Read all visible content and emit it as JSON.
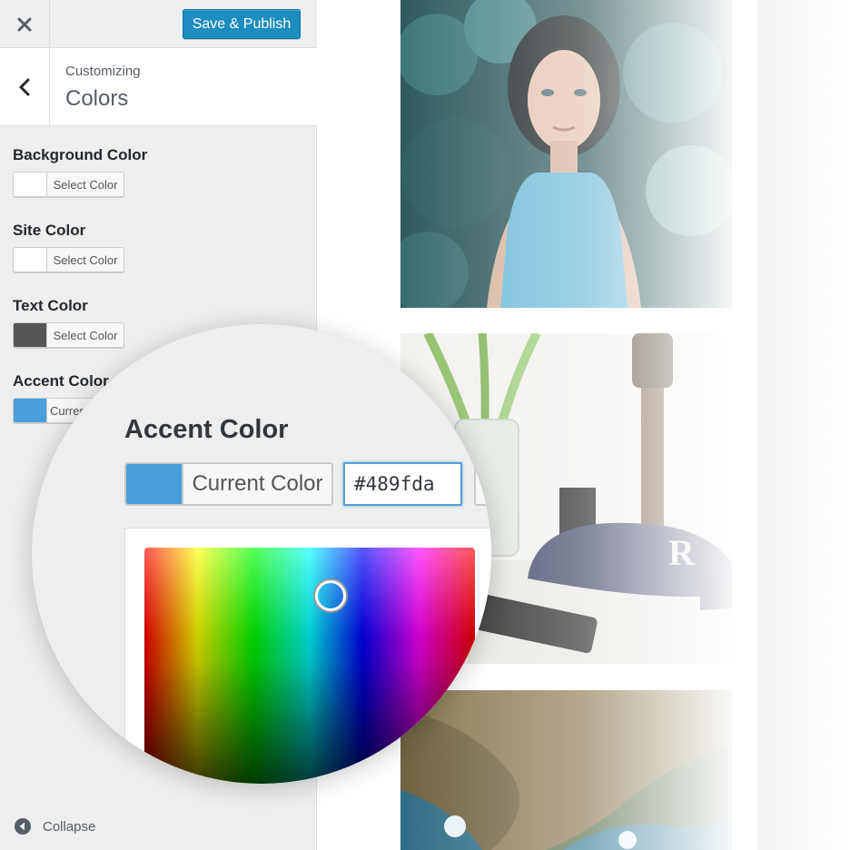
{
  "toolbar": {
    "close_icon": "close-icon",
    "publish_label": "Save & Publish"
  },
  "header": {
    "back_icon": "chevron-left-icon",
    "breadcrumb": "Customizing",
    "title": "Colors"
  },
  "controls": [
    {
      "label": "Background Color",
      "button_text": "Select Color",
      "swatch": "#ffffff"
    },
    {
      "label": "Site Color",
      "button_text": "Select Color",
      "swatch": "#ffffff"
    },
    {
      "label": "Text Color",
      "button_text": "Select Color",
      "swatch": "#555555"
    },
    {
      "label": "Accent Color",
      "button_text": "Current Color",
      "swatch": "#489fda"
    }
  ],
  "magnifier": {
    "title": "Accent Color",
    "button_text": "Current Color",
    "hex_value": "#489fda",
    "swatch": "#489fda"
  },
  "footer": {
    "collapse_label": "Collapse",
    "collapse_icon": "arrow-left-circle-icon"
  },
  "colors": {
    "primary_button": "#1e8cbe",
    "accent": "#489fda",
    "sidebar_bg": "#eeeeee"
  }
}
